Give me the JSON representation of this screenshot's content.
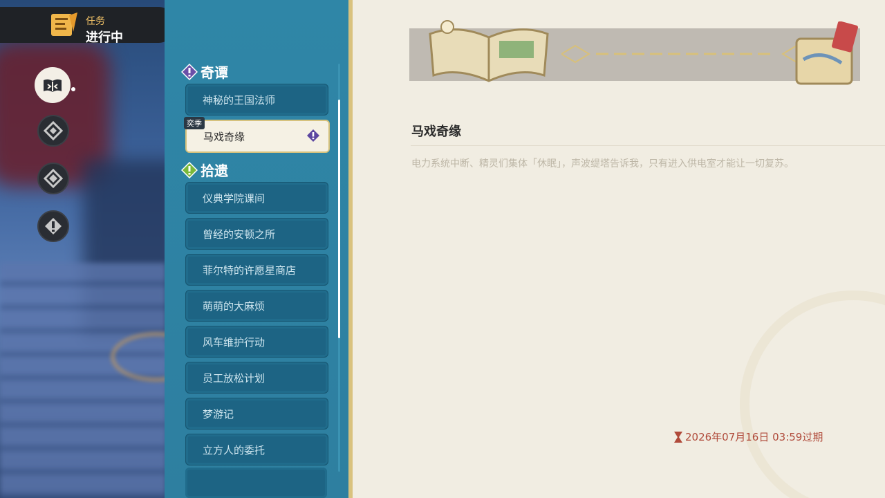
{
  "header": {
    "small_label": "任务",
    "big_label": "进行中"
  },
  "categories": [
    {
      "name": "奇谭",
      "icon": "purple-exclamation-diamond-icon",
      "color": "#6a4fa8"
    },
    {
      "name": "拾遗",
      "icon": "green-exclamation-diamond-icon",
      "color": "#7ab83a"
    }
  ],
  "quests": {
    "qitan": [
      {
        "label": "神秘的王国法师"
      },
      {
        "label": "马戏奇缘",
        "tag": "奕季",
        "selected": true
      }
    ],
    "shiyi": [
      {
        "label": "仪典学院课间"
      },
      {
        "label": "曾经的安顿之所"
      },
      {
        "label": "菲尔特的许愿星商店"
      },
      {
        "label": "萌萌的大麻烦"
      },
      {
        "label": "风车维护行动"
      },
      {
        "label": "员工放松计划"
      },
      {
        "label": "梦游记"
      },
      {
        "label": "立方人的委托"
      }
    ]
  },
  "detail": {
    "title": "马戏奇缘",
    "description": "电力系统中断、精灵们集体「休眠」，声波缇塔告诉我，只有进入供电室才能让一切复苏。",
    "expiry": "2026年07月16日 03:59过期"
  },
  "colors": {
    "accent_gold": "#d6c27d",
    "panel_blue": "#2f86a7",
    "expiry_red": "#b04a3a"
  }
}
